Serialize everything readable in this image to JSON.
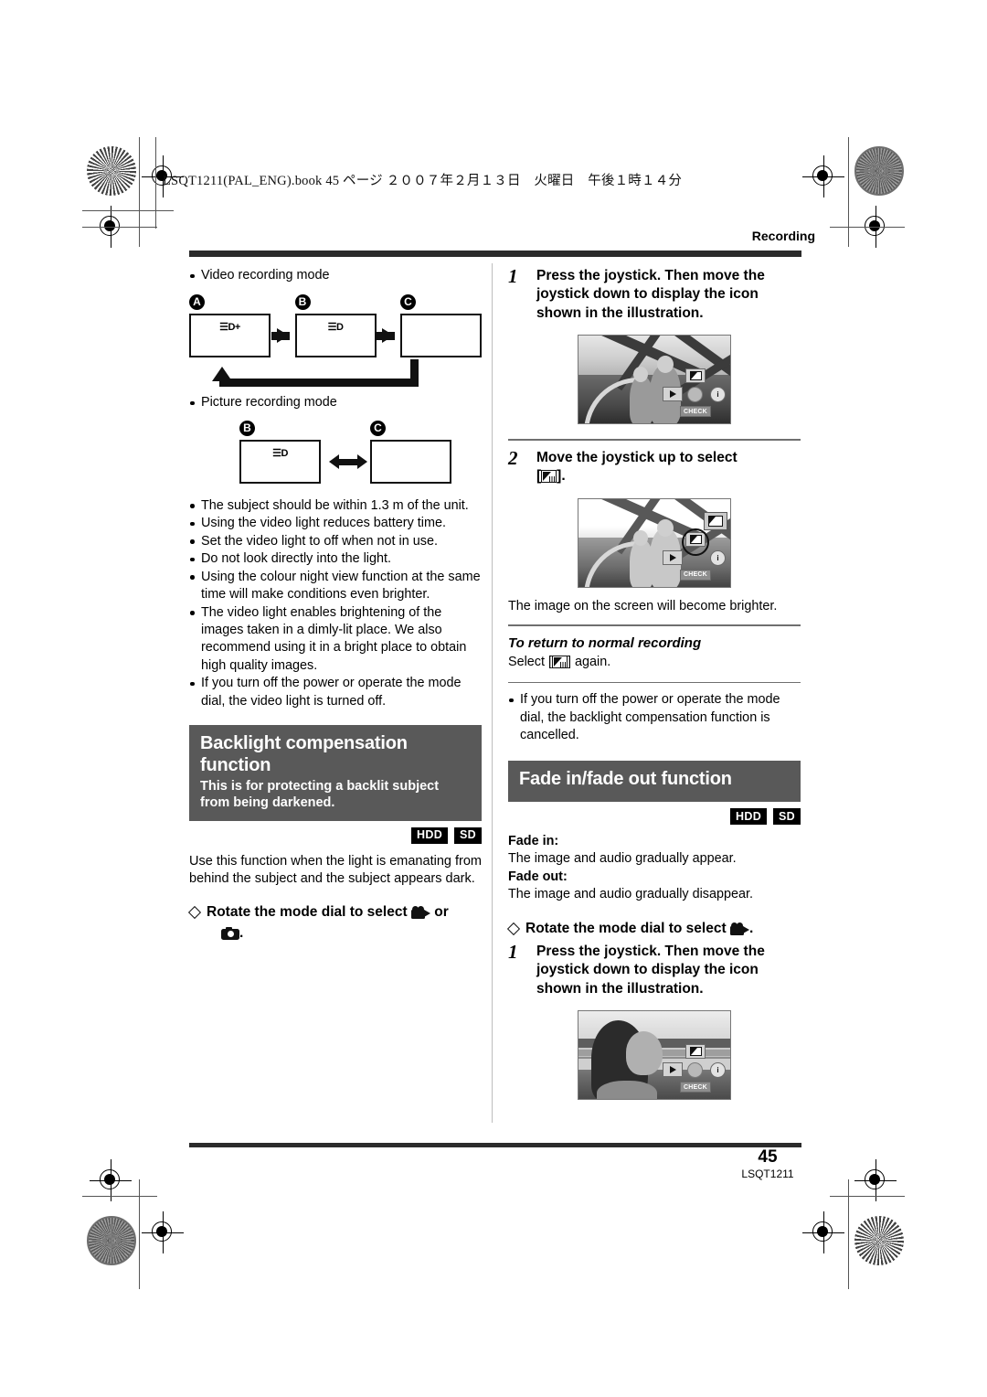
{
  "page": {
    "book_line": "LSQT1211(PAL_ENG).book  45 ページ  ２００７年２月１３日　火曜日　午後１時１４分",
    "running_head": "Recording",
    "folio_number": "45",
    "folio_code": "LSQT1211"
  },
  "left": {
    "video_mode_label": "Video recording mode",
    "picture_mode_label": "Picture recording mode",
    "diagram": {
      "video_steps": [
        {
          "label": "A",
          "icon": "video-light-plus-icon",
          "icon_text": "☰D+"
        },
        {
          "label": "B",
          "icon": "video-light-icon",
          "icon_text": "☰D"
        },
        {
          "label": "C",
          "icon": "none",
          "icon_text": ""
        }
      ],
      "picture_steps": [
        {
          "label": "B",
          "icon": "video-light-icon",
          "icon_text": "☰D"
        },
        {
          "label": "C",
          "icon": "none",
          "icon_text": ""
        }
      ]
    },
    "notes": [
      "The subject should be within 1.3 m of the unit.",
      "Using the video light reduces battery time.",
      "Set the video light to off when not in use.",
      "Do not look directly into the light.",
      "Using the colour night view function at the same time will make conditions even brighter.",
      "The video light enables brightening of the images taken in a dimly-lit place. We also recommend using it in a bright place to obtain high quality images.",
      "If you turn off the power or operate the mode dial, the video light is turned off."
    ],
    "section": {
      "title": "Backlight compensation function",
      "subtitle": "This is for protecting a backlit subject from being darkened.",
      "badges": [
        "HDD",
        "SD"
      ],
      "body": "Use this function when the light is emanating from behind the subject and the subject appears dark.",
      "mode_dial_pre": "Rotate the mode dial to select",
      "mode_dial_mid": "or",
      "mode_dial_post": "."
    }
  },
  "right": {
    "step1": {
      "number": "1",
      "text": "Press the joystick. Then move the joystick down to display the icon shown in the illustration."
    },
    "step2": {
      "number": "2",
      "text_pre": "Move the joystick up to select",
      "text_bracket_open": "[",
      "text_bracket_close": "].",
      "caption": "The image on the screen will become brighter."
    },
    "return": {
      "heading": "To return to normal recording",
      "line_pre": "Select [",
      "line_post": "] again."
    },
    "note": "If you turn off the power or operate the mode dial, the backlight compensation function is cancelled.",
    "section": {
      "title": "Fade in/fade out function",
      "badges": [
        "HDD",
        "SD"
      ],
      "fade_in_label": "Fade in:",
      "fade_in_text": "The image and audio gradually appear.",
      "fade_out_label": "Fade out:",
      "fade_out_text": "The image and audio gradually disappear.",
      "mode_dial_pre": "Rotate the mode dial to select",
      "mode_dial_post": "."
    },
    "step1b": {
      "number": "1",
      "text": "Press the joystick. Then move the joystick down to display the icon shown in the illustration."
    },
    "joystick": {
      "left_icon": "arrow-right-icon",
      "right_icon": "info-icon",
      "right_label": "i",
      "bottom_label": "CHECK",
      "top_icon": "backlight-compensation-icon"
    }
  },
  "colors": {
    "banner_bg": "#595959",
    "badge_bg": "#000000",
    "rule": "#2b2b2b"
  }
}
